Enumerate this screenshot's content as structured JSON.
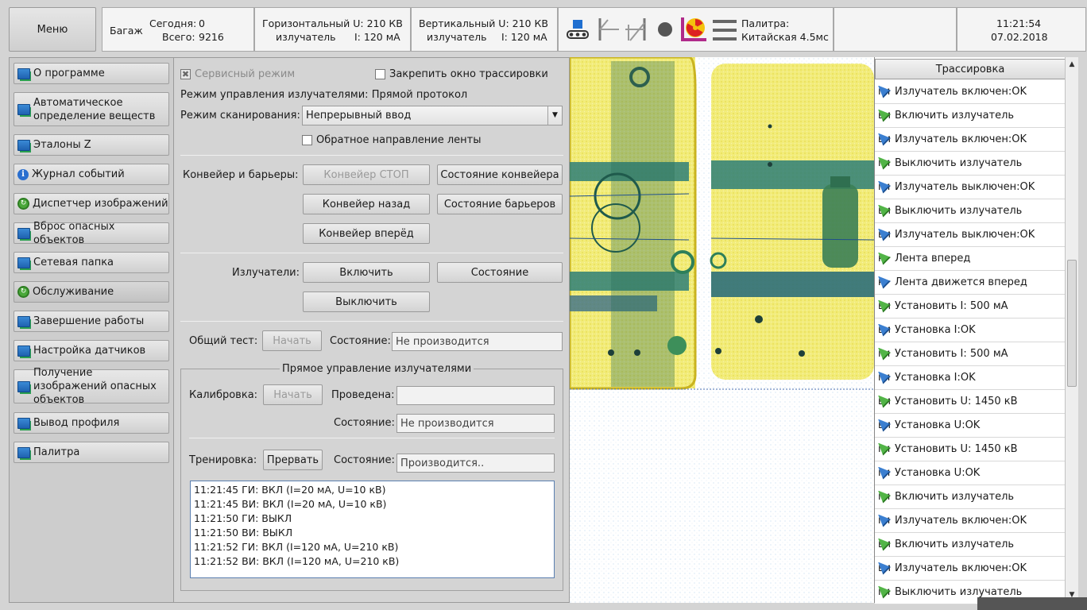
{
  "topbar": {
    "menu_label": "Меню",
    "baggage": {
      "label": "Багаж",
      "today_label": "Сегодня:",
      "today_value": "0",
      "total_label": "Всего:",
      "total_value": "9216"
    },
    "horizontal": {
      "line1": "Горизонтальный U: 210 КВ",
      "emitter_label": "излучатель",
      "current": "I: 120 мА"
    },
    "vertical": {
      "line1": "Вертикальный U: 210 КВ",
      "emitter_label": "излучатель",
      "current": "I: 120 мА"
    },
    "palette": {
      "label": "Палитра:",
      "value": "Китайская 4.5мс"
    },
    "clock": {
      "time": "11:21:54",
      "date": "07.02.2018"
    }
  },
  "sidebar": {
    "items": [
      {
        "label": "О программе",
        "icon": "monitor-icon"
      },
      {
        "label": "Автоматическое определение веществ",
        "icon": "monitor-icon"
      },
      {
        "label": "Эталоны Z",
        "icon": "monitor-icon"
      },
      {
        "label": "Журнал событий",
        "icon": "info-icon"
      },
      {
        "label": "Диспетчер изображений",
        "icon": "refresh-icon"
      },
      {
        "label": "Вброс опасных объектов",
        "icon": "monitor-icon"
      },
      {
        "label": "Сетевая папка",
        "icon": "monitor-icon"
      },
      {
        "label": "Обслуживание",
        "icon": "refresh-icon"
      },
      {
        "label": "Завершение работы",
        "icon": "monitor-icon"
      },
      {
        "label": "Настройка датчиков",
        "icon": "monitor-icon"
      },
      {
        "label": "Получение изображений опасных объектов",
        "icon": "monitor-icon"
      },
      {
        "label": "Вывод профиля",
        "icon": "monitor-icon"
      },
      {
        "label": "Палитра",
        "icon": "monitor-icon"
      }
    ]
  },
  "panel": {
    "service_mode": "Сервисный режим",
    "pin_trace": "Закрепить окно трассировки",
    "emitter_control_mode": "Режим управления излучателями: Прямой протокол",
    "scan_mode_label": "Режим сканирования:",
    "scan_mode_value": "Непрерывный ввод",
    "reverse_belt": "Обратное направление ленты",
    "conveyor_label": "Конвейер и барьеры:",
    "conveyor_stop": "Конвейер СТОП",
    "conveyor_state": "Состояние конвейера",
    "conveyor_back": "Конвейер назад",
    "barrier_state": "Состояние барьеров",
    "conveyor_forward": "Конвейер вперёд",
    "emitters_label": "Излучатели:",
    "emitters_on": "Включить",
    "emitters_state": "Состояние",
    "emitters_off": "Выключить",
    "general_test_label": "Общий тест:",
    "general_test_start": "Начать",
    "state_label": "Состояние:",
    "general_test_state": "Не производится",
    "direct_control_title": "Прямое управление излучателями",
    "calibration_label": "Калибровка:",
    "calibration_start": "Начать",
    "performed_label": "Проведена:",
    "performed_value": "",
    "calibration_state": "Не производится",
    "training_label": "Тренировка:",
    "training_abort": "Прервать",
    "training_state": "Производится..",
    "log": [
      "11:21:45 ГИ: ВКЛ (I=20 мА, U=10 кВ)",
      "11:21:45 ВИ: ВКЛ (I=20 мА, U=10 кВ)",
      "11:21:50 ГИ: ВЫКЛ",
      "11:21:50 ВИ: ВЫКЛ",
      "11:21:52 ГИ: ВКЛ (I=120 мА, U=210 кВ)",
      "11:21:52 ВИ: ВКЛ (I=120 мА, U=210 кВ)"
    ]
  },
  "trace": {
    "title": "Трассировка",
    "items": [
      {
        "text": "Излучатель включен:OK",
        "dir": "out",
        "tag": "ги"
      },
      {
        "text": "Включить излучатель",
        "dir": "in",
        "tag": "ви"
      },
      {
        "text": "Излучатель включен:OK",
        "dir": "out",
        "tag": "ви"
      },
      {
        "text": "Выключить излучатель",
        "dir": "in",
        "tag": "ги"
      },
      {
        "text": "Излучатель выключен:OK",
        "dir": "out",
        "tag": "ги"
      },
      {
        "text": "Выключить излучатель",
        "dir": "in",
        "tag": "ви"
      },
      {
        "text": "Излучатель выключен:OK",
        "dir": "out",
        "tag": "ви"
      },
      {
        "text": "Лента вперед",
        "dir": "in",
        "tag": "к"
      },
      {
        "text": "Лента движется вперед",
        "dir": "out",
        "tag": "к"
      },
      {
        "text": "Установить I: 500 мА",
        "dir": "in",
        "tag": "ви"
      },
      {
        "text": "Установка I:OK",
        "dir": "out",
        "tag": "ви"
      },
      {
        "text": "Установить I: 500 мА",
        "dir": "in",
        "tag": "ги"
      },
      {
        "text": "Установка I:OK",
        "dir": "out",
        "tag": "ги"
      },
      {
        "text": "Установить U: 1450 кВ",
        "dir": "in",
        "tag": "ви"
      },
      {
        "text": "Установка U:OK",
        "dir": "out",
        "tag": "ви"
      },
      {
        "text": "Установить U: 1450 кВ",
        "dir": "in",
        "tag": "ги"
      },
      {
        "text": "Установка U:OK",
        "dir": "out",
        "tag": "ги"
      },
      {
        "text": "Включить излучатель",
        "dir": "in",
        "tag": "ги"
      },
      {
        "text": "Излучатель включен:OK",
        "dir": "out",
        "tag": "ги"
      },
      {
        "text": "Включить излучатель",
        "dir": "in",
        "tag": "ви"
      },
      {
        "text": "Излучатель включен:OK",
        "dir": "out",
        "tag": "ви"
      },
      {
        "text": "Выключить излучатель",
        "dir": "in",
        "tag": "ги"
      }
    ]
  },
  "colors": {
    "xray_yellow": "#f0e860",
    "xray_green": "#2f7f5a",
    "xray_blue": "#1e4f8a"
  }
}
